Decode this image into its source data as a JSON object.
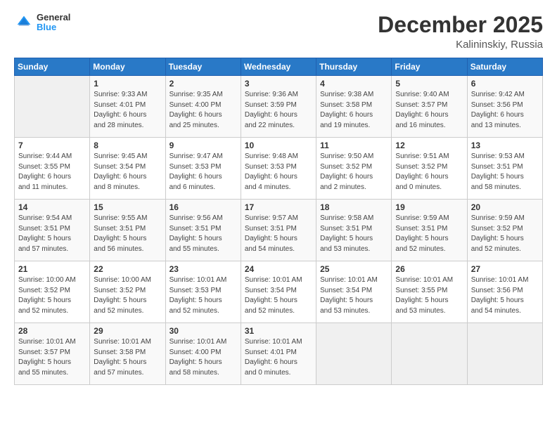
{
  "header": {
    "logo_line1": "General",
    "logo_line2": "Blue",
    "month": "December 2025",
    "location": "Kalininskiy, Russia"
  },
  "days_of_week": [
    "Sunday",
    "Monday",
    "Tuesday",
    "Wednesday",
    "Thursday",
    "Friday",
    "Saturday"
  ],
  "weeks": [
    [
      {
        "day": "",
        "info": ""
      },
      {
        "day": "1",
        "info": "Sunrise: 9:33 AM\nSunset: 4:01 PM\nDaylight: 6 hours\nand 28 minutes."
      },
      {
        "day": "2",
        "info": "Sunrise: 9:35 AM\nSunset: 4:00 PM\nDaylight: 6 hours\nand 25 minutes."
      },
      {
        "day": "3",
        "info": "Sunrise: 9:36 AM\nSunset: 3:59 PM\nDaylight: 6 hours\nand 22 minutes."
      },
      {
        "day": "4",
        "info": "Sunrise: 9:38 AM\nSunset: 3:58 PM\nDaylight: 6 hours\nand 19 minutes."
      },
      {
        "day": "5",
        "info": "Sunrise: 9:40 AM\nSunset: 3:57 PM\nDaylight: 6 hours\nand 16 minutes."
      },
      {
        "day": "6",
        "info": "Sunrise: 9:42 AM\nSunset: 3:56 PM\nDaylight: 6 hours\nand 13 minutes."
      }
    ],
    [
      {
        "day": "7",
        "info": "Sunrise: 9:44 AM\nSunset: 3:55 PM\nDaylight: 6 hours\nand 11 minutes."
      },
      {
        "day": "8",
        "info": "Sunrise: 9:45 AM\nSunset: 3:54 PM\nDaylight: 6 hours\nand 8 minutes."
      },
      {
        "day": "9",
        "info": "Sunrise: 9:47 AM\nSunset: 3:53 PM\nDaylight: 6 hours\nand 6 minutes."
      },
      {
        "day": "10",
        "info": "Sunrise: 9:48 AM\nSunset: 3:53 PM\nDaylight: 6 hours\nand 4 minutes."
      },
      {
        "day": "11",
        "info": "Sunrise: 9:50 AM\nSunset: 3:52 PM\nDaylight: 6 hours\nand 2 minutes."
      },
      {
        "day": "12",
        "info": "Sunrise: 9:51 AM\nSunset: 3:52 PM\nDaylight: 6 hours\nand 0 minutes."
      },
      {
        "day": "13",
        "info": "Sunrise: 9:53 AM\nSunset: 3:51 PM\nDaylight: 5 hours\nand 58 minutes."
      }
    ],
    [
      {
        "day": "14",
        "info": "Sunrise: 9:54 AM\nSunset: 3:51 PM\nDaylight: 5 hours\nand 57 minutes."
      },
      {
        "day": "15",
        "info": "Sunrise: 9:55 AM\nSunset: 3:51 PM\nDaylight: 5 hours\nand 56 minutes."
      },
      {
        "day": "16",
        "info": "Sunrise: 9:56 AM\nSunset: 3:51 PM\nDaylight: 5 hours\nand 55 minutes."
      },
      {
        "day": "17",
        "info": "Sunrise: 9:57 AM\nSunset: 3:51 PM\nDaylight: 5 hours\nand 54 minutes."
      },
      {
        "day": "18",
        "info": "Sunrise: 9:58 AM\nSunset: 3:51 PM\nDaylight: 5 hours\nand 53 minutes."
      },
      {
        "day": "19",
        "info": "Sunrise: 9:59 AM\nSunset: 3:51 PM\nDaylight: 5 hours\nand 52 minutes."
      },
      {
        "day": "20",
        "info": "Sunrise: 9:59 AM\nSunset: 3:52 PM\nDaylight: 5 hours\nand 52 minutes."
      }
    ],
    [
      {
        "day": "21",
        "info": "Sunrise: 10:00 AM\nSunset: 3:52 PM\nDaylight: 5 hours\nand 52 minutes."
      },
      {
        "day": "22",
        "info": "Sunrise: 10:00 AM\nSunset: 3:52 PM\nDaylight: 5 hours\nand 52 minutes."
      },
      {
        "day": "23",
        "info": "Sunrise: 10:01 AM\nSunset: 3:53 PM\nDaylight: 5 hours\nand 52 minutes."
      },
      {
        "day": "24",
        "info": "Sunrise: 10:01 AM\nSunset: 3:54 PM\nDaylight: 5 hours\nand 52 minutes."
      },
      {
        "day": "25",
        "info": "Sunrise: 10:01 AM\nSunset: 3:54 PM\nDaylight: 5 hours\nand 53 minutes."
      },
      {
        "day": "26",
        "info": "Sunrise: 10:01 AM\nSunset: 3:55 PM\nDaylight: 5 hours\nand 53 minutes."
      },
      {
        "day": "27",
        "info": "Sunrise: 10:01 AM\nSunset: 3:56 PM\nDaylight: 5 hours\nand 54 minutes."
      }
    ],
    [
      {
        "day": "28",
        "info": "Sunrise: 10:01 AM\nSunset: 3:57 PM\nDaylight: 5 hours\nand 55 minutes."
      },
      {
        "day": "29",
        "info": "Sunrise: 10:01 AM\nSunset: 3:58 PM\nDaylight: 5 hours\nand 57 minutes."
      },
      {
        "day": "30",
        "info": "Sunrise: 10:01 AM\nSunset: 4:00 PM\nDaylight: 5 hours\nand 58 minutes."
      },
      {
        "day": "31",
        "info": "Sunrise: 10:01 AM\nSunset: 4:01 PM\nDaylight: 6 hours\nand 0 minutes."
      },
      {
        "day": "",
        "info": ""
      },
      {
        "day": "",
        "info": ""
      },
      {
        "day": "",
        "info": ""
      }
    ]
  ]
}
